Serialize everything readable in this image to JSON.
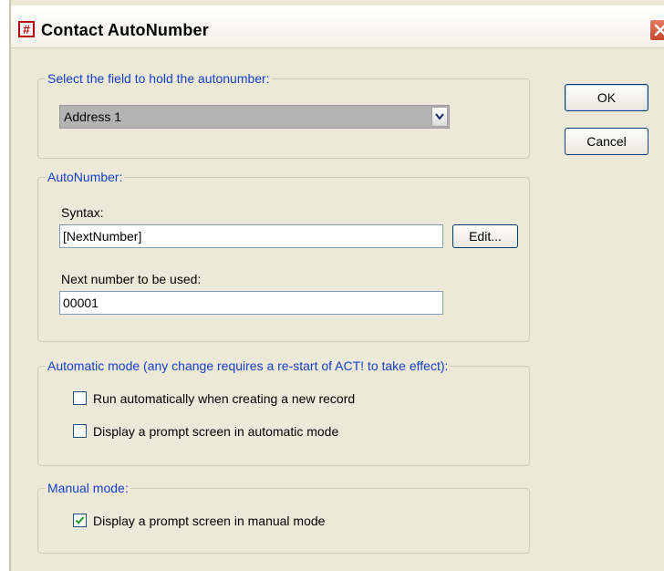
{
  "window": {
    "title": "Contact AutoNumber",
    "icon_glyph": "#",
    "icons": {
      "app": "app-icon",
      "close": "close-icon"
    }
  },
  "buttons": {
    "ok": "OK",
    "cancel": "Cancel",
    "edit": "Edit..."
  },
  "field_group": {
    "legend": "Select the field to hold the autonumber:",
    "selected_value": "Address 1"
  },
  "autonumber_group": {
    "legend": "AutoNumber:",
    "syntax_label": "Syntax:",
    "syntax_value": "[NextNumber]",
    "next_label": "Next number to be used:",
    "next_value": "00001"
  },
  "automatic_group": {
    "legend": "Automatic mode (any change requires a re-start of ACT! to take effect):",
    "run_auto": {
      "label": "Run automatically when creating a new record",
      "checked": false
    },
    "prompt_auto": {
      "label": "Display a prompt screen in automatic mode",
      "checked": false
    }
  },
  "manual_group": {
    "legend": "Manual mode:",
    "prompt_manual": {
      "label": "Display a prompt screen in manual mode",
      "checked": true
    }
  },
  "colors": {
    "legend": "#1640c9",
    "dialog_bg": "#ece9d8",
    "checkmark": "#21a121"
  }
}
